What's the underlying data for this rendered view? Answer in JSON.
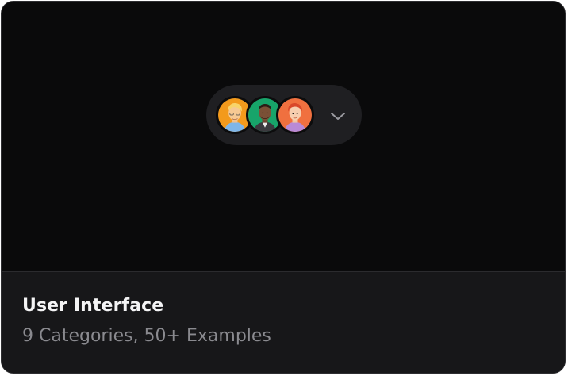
{
  "card": {
    "title": "User Interface",
    "subtitle": "9 Categories, 50+ Examples"
  },
  "avatar_group": {
    "avatars": [
      {
        "name": "avatar-orange-blond",
        "bg": "#f39a1c"
      },
      {
        "name": "avatar-green-dark",
        "bg": "#17a46a"
      },
      {
        "name": "avatar-coral-redhead",
        "bg": "#f0703f"
      }
    ],
    "expand_icon": "chevron-down-icon"
  },
  "colors": {
    "card_bg": "#0a0a0b",
    "footer_bg": "#171719",
    "pill_bg": "#1f1f22",
    "title": "#f4f4f5",
    "subtitle": "#8a8a8f"
  }
}
